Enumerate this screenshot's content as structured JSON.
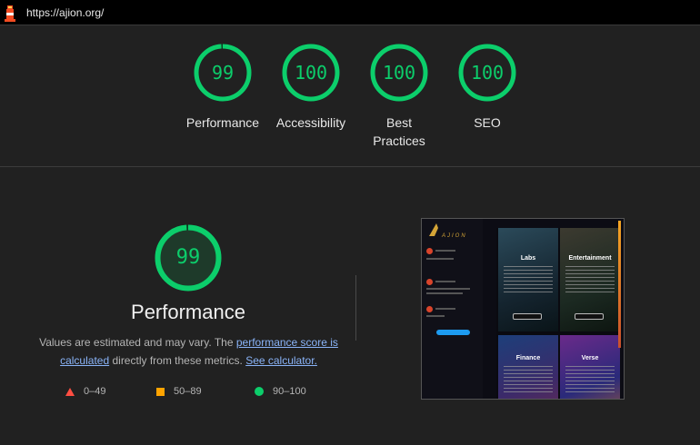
{
  "browser": {
    "url": "https://ajion.org/",
    "logo_icon": "lighthouse-icon"
  },
  "gauges": [
    {
      "value": "99",
      "label": "Performance",
      "score": 0.99
    },
    {
      "value": "100",
      "label": "Accessibility",
      "score": 1.0
    },
    {
      "value": "100",
      "label": "Best Practices",
      "score": 1.0
    },
    {
      "value": "100",
      "label": "SEO",
      "score": 1.0
    }
  ],
  "performance": {
    "value": "99",
    "score": 0.99,
    "title": "Performance",
    "desc_prefix": "Values are estimated and may vary. The ",
    "link_score": "performance score is calculated",
    "desc_middle": " directly from these metrics. ",
    "link_calc": "See calculator."
  },
  "legend": {
    "fail": "0–49",
    "average": "50–89",
    "pass": "90–100"
  },
  "thumbnail": {
    "brand": "AJION",
    "tiles": [
      "Labs",
      "Entertainment",
      "Finance",
      "Verse"
    ]
  },
  "colors": {
    "pass": "#0cce6b",
    "average": "#ffa400",
    "fail": "#ff4e42",
    "link": "#8ab4f8",
    "background": "#212121"
  }
}
